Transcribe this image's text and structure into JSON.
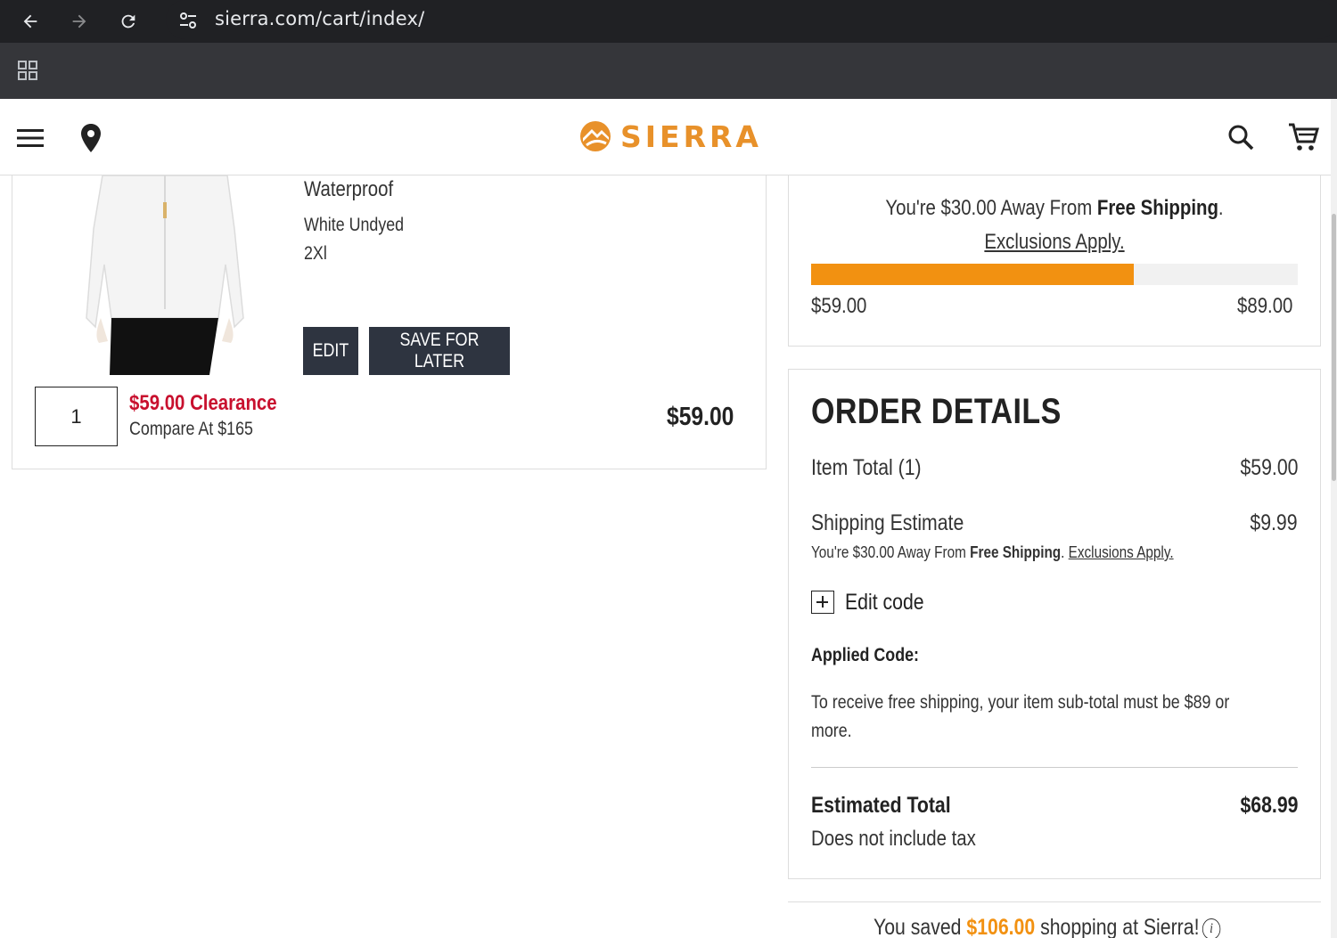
{
  "browser": {
    "url": "sierra.com/cart/index/"
  },
  "header": {
    "logo_text": "SIERRA",
    "brand_color": "#e8912a"
  },
  "product": {
    "name_line": "Waterproof",
    "color": "White Undyed",
    "size": "2Xl",
    "edit_label": "EDIT",
    "save_for_later_label": "SAVE FOR LATER",
    "quantity": "1",
    "sale_price": "$59.00 Clearance",
    "compare_price": "Compare At $165",
    "line_total": "$59.00"
  },
  "shipping_progress": {
    "msg_prefix": "You're $30.00 Away From ",
    "msg_bold": "Free Shipping",
    "msg_dot": ". ",
    "exclusions": "Exclusions Apply.",
    "start_label": "$59.00",
    "end_label": "$89.00",
    "progress_fraction": 0.663,
    "fill_color": "#f29111"
  },
  "order_details": {
    "title": "ORDER DETAILS",
    "item_total_label": "Item Total (1)",
    "item_total_value": "$59.00",
    "shipping_label": "Shipping Estimate",
    "shipping_value": "$9.99",
    "shipping_note_prefix": "You're $30.00 Away From ",
    "shipping_note_bold": "Free Shipping",
    "shipping_note_dot": ". ",
    "shipping_note_link": "Exclusions Apply.",
    "edit_code_label": "Edit code",
    "applied_code_label": "Applied Code:",
    "applied_code_message": "To receive free shipping, your item sub-total must be $89 or more.",
    "estimated_total_label": "Estimated Total",
    "estimated_total_value": "$68.99",
    "tax_note": "Does not include tax"
  },
  "savings": {
    "prefix": "You saved ",
    "amount": "$106.00",
    "suffix": " shopping at Sierra!",
    "info_icon": "i"
  }
}
